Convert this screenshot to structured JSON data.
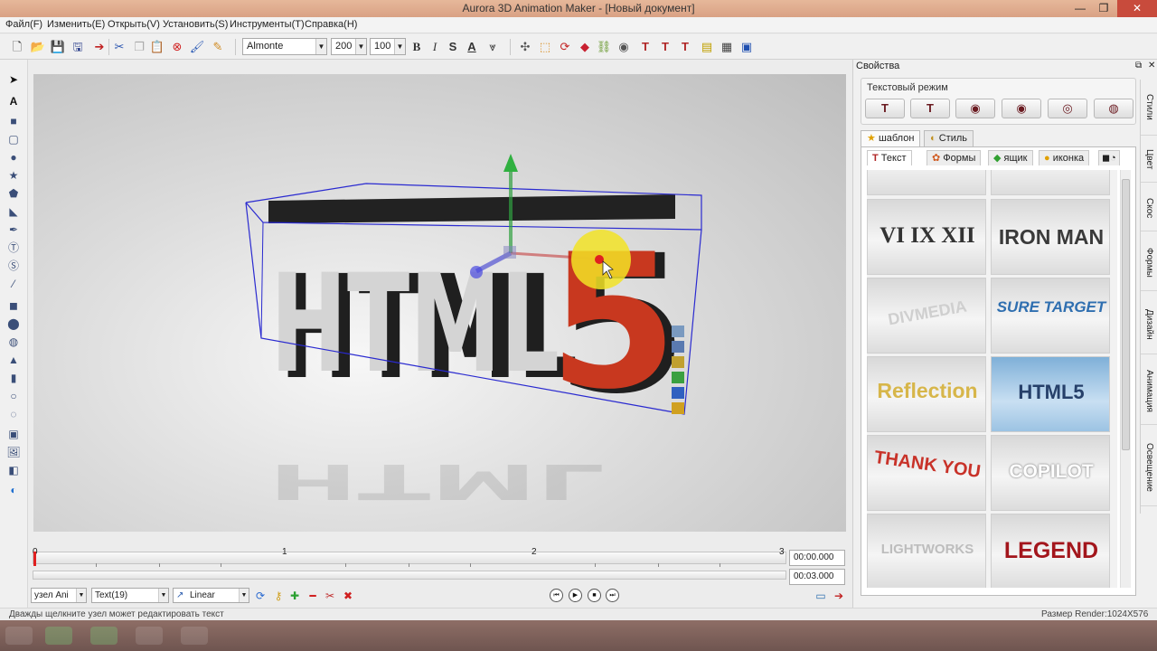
{
  "window": {
    "title": "Aurora 3D Animation Maker - [Новый документ]",
    "min_label": "—",
    "max_label": "❐",
    "close_label": "✕"
  },
  "menu": [
    "Файл(F)",
    "Изменить(E)",
    "Открыть(V)",
    "Установить(S)",
    "Инструменты(T)",
    "Справка(H)"
  ],
  "toolbar": {
    "font": "Almonte",
    "size": "200",
    "scale": "100",
    "bold": "B",
    "italic": "I",
    "strike": "S",
    "text_a": "A"
  },
  "scene": {
    "text_main": "HTML",
    "text_five": "5",
    "colors": {
      "letters": "#d4d4d4",
      "five": "#c8381f",
      "bbox": "#2a2ad0",
      "handle": "#f2e326"
    }
  },
  "timeline": {
    "ticks": [
      "0",
      "1",
      "2",
      "3"
    ],
    "current_time": "00:00.000",
    "total_time": "00:03.000"
  },
  "controls": {
    "node": "узел Ani",
    "object": "Text(19)",
    "interp": "Linear"
  },
  "status": {
    "hint": "Дважды щелкните узел может редактировать текст",
    "render_size": "Размер Render:1024X576"
  },
  "panel": {
    "title": "Свойства",
    "mode_label": "Текстовый режим",
    "tabs": [
      "шаблон",
      "Стиль"
    ],
    "lib_tabs": [
      "Текст",
      "Формы",
      "ящик",
      "иконка"
    ],
    "thumbnails": [
      {
        "text": "VI IX XII",
        "color": "#333333"
      },
      {
        "text": "IRON MAN",
        "color": "#3a3a3a"
      },
      {
        "text": "DIVMEDIA",
        "color": "#cfcfcf"
      },
      {
        "text": "SURE TARGET",
        "color": "#2f6fb0"
      },
      {
        "text": "Reflection",
        "color": "#d7b64a"
      },
      {
        "text": "HTML5",
        "color": "#26406a"
      },
      {
        "text": "THANK YOU",
        "color": "#c83229"
      },
      {
        "text": "COPILOT",
        "color": "#ffffff"
      },
      {
        "text": "LIGHTWORKS",
        "color": "#bdbdbd"
      },
      {
        "text": "LEGEND",
        "color": "#a3161c"
      }
    ],
    "vtabs": [
      "Стили",
      "Цвет",
      "Скос",
      "Формы",
      "Дизайн",
      "Анимация",
      "Освещение"
    ]
  }
}
